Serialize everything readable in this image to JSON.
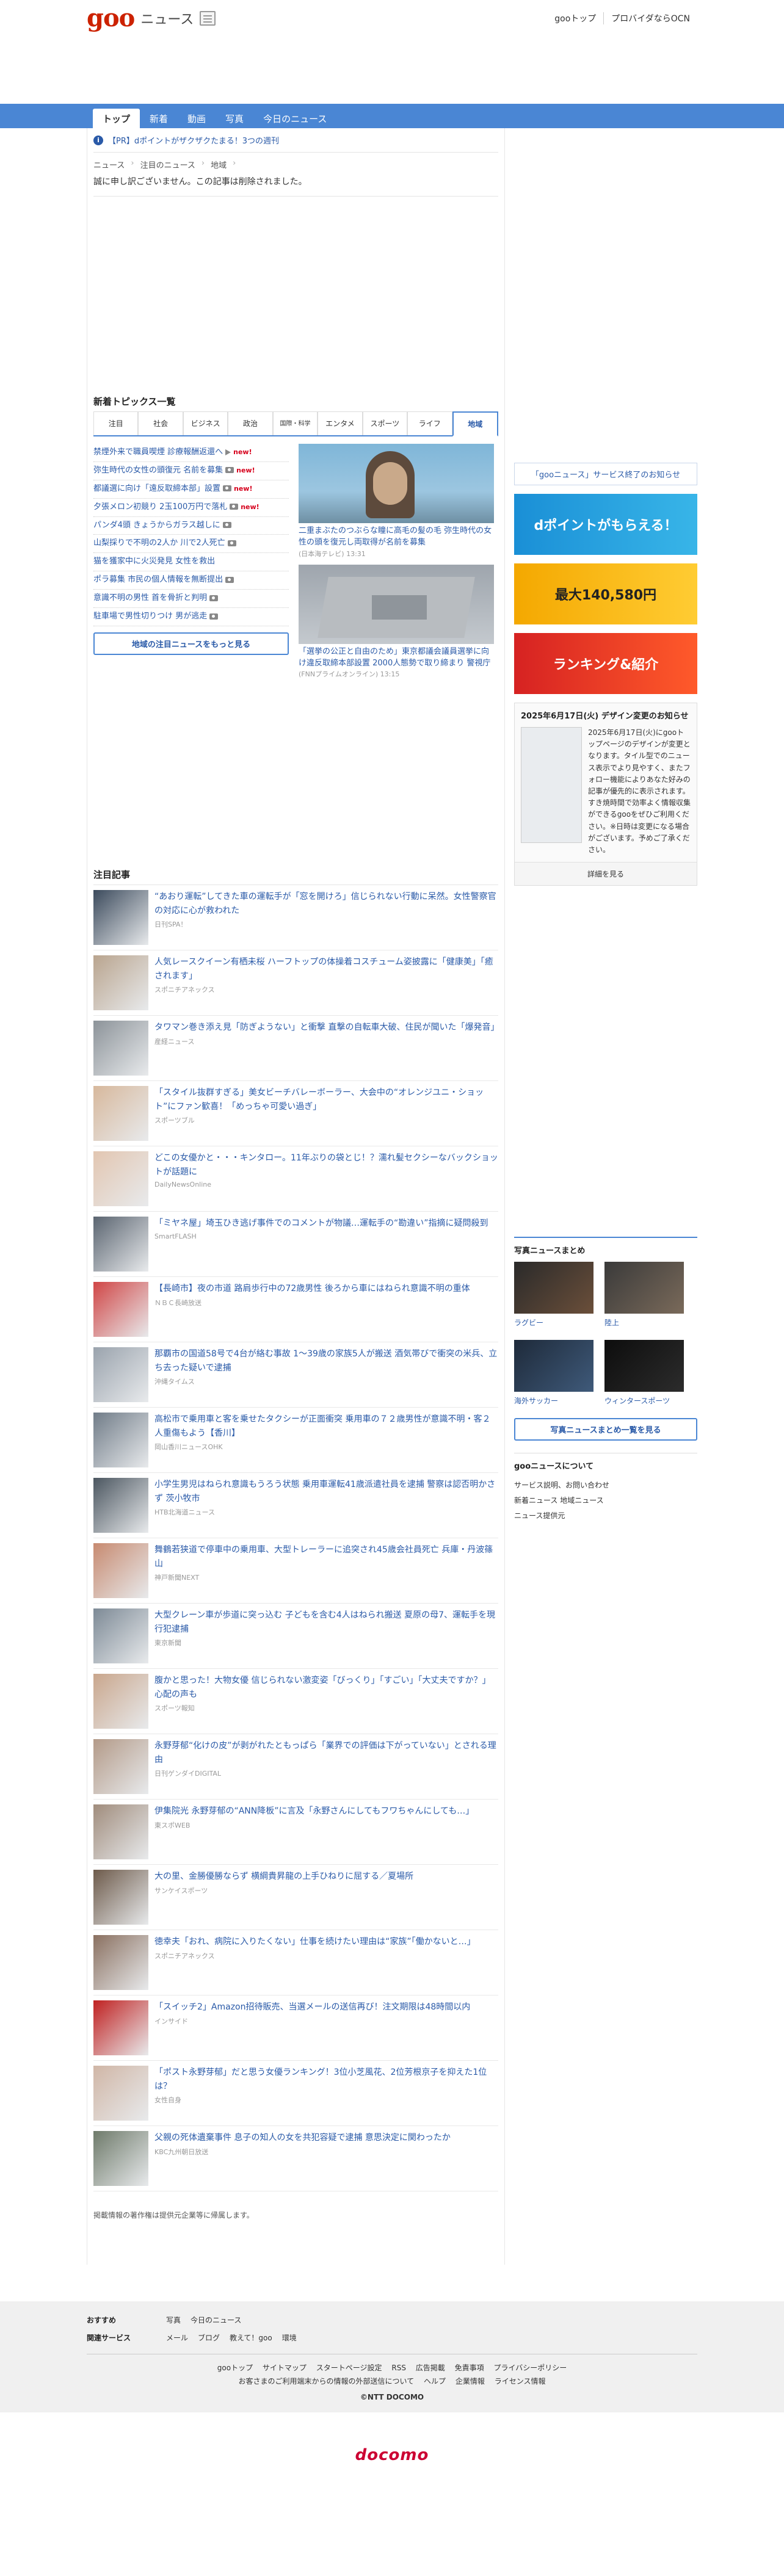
{
  "header": {
    "logo": "goo",
    "logo_sub": "ニュース",
    "links": [
      "gooトップ",
      "プロバイダならOCN"
    ]
  },
  "gnav": [
    "トップ",
    "新着",
    "動画",
    "写真",
    "今日のニュース"
  ],
  "pr": "【PR】dポイントがザクザクたまる！3つの週刊",
  "breadcrumb": [
    "ニュース",
    "注目のニュース",
    "地域"
  ],
  "deleted_msg": "誠に申し訳ございません。この記事は削除されました。",
  "topics": {
    "heading": "新着トピックス一覧",
    "tabs": [
      "注目",
      "社会",
      "ビジネス",
      "政治",
      "国際・科学",
      "エンタメ",
      "スポーツ",
      "ライフ",
      "地域"
    ],
    "items": [
      {
        "text": "禁煙外来で職員喫煙 診療報酬返還へ",
        "icon": "video",
        "new": "new!"
      },
      {
        "text": "弥生時代の女性の頭復元 名前を募集",
        "icon": "camera",
        "new": "new!"
      },
      {
        "text": "都議選に向け「遠反取締本部」設置",
        "icon": "camera",
        "new": "new!"
      },
      {
        "text": "夕張メロン初競り 2玉100万円で落札",
        "icon": "camera",
        "new": "new!"
      },
      {
        "text": "パンダ4頭 きょうからガラス越しに",
        "icon": "camera",
        "new": ""
      },
      {
        "text": "山梨採りで不明の2人か 川で2人死亡",
        "icon": "camera",
        "new": ""
      },
      {
        "text": "猫を獲家中に火災発見 女性を救出",
        "icon": "",
        "new": ""
      },
      {
        "text": "ポラ募集 市民の個人情報を無断提出",
        "icon": "camera",
        "new": ""
      },
      {
        "text": "意識不明の男性 首を骨折と判明",
        "icon": "camera",
        "new": ""
      },
      {
        "text": "駐車場で男性切りつけ 男が逃走",
        "icon": "camera",
        "new": ""
      }
    ],
    "more": "地域の注目ニュースをもっと見る",
    "pics": [
      {
        "cap": "二重まぶたのつぶらな瞳に高毛の髪の毛 弥生時代の女性の頭を復元し両取得が名前を募集",
        "src": "(日本海テレビ) 13:31"
      },
      {
        "cap": "「選挙の公正と自由のため」東京都議会議員選挙に向け違反取締本部設置 2000人態勢で取り締まり 警視庁",
        "src": "(FNNプライムオンライン) 13:15"
      }
    ]
  },
  "featured": {
    "heading": "注目記事",
    "items": [
      {
        "title": "“あおり運転”してきた車の運転手が「窓を開けろ」信じられない行動に呆然。女性警察官の対応に心が救われた",
        "src": "日刊SPA！"
      },
      {
        "title": "人気レースクイーン有栖未桜 ハーフトップの体操着コスチューム姿披露に「健康美」「癒されます」",
        "src": "スポニチアネックス"
      },
      {
        "title": "タワマン巻き添え見「防ぎようない」と衝撃 直撃の自転車大破、住民が聞いた「爆発音」",
        "src": "産経ニュース"
      },
      {
        "title": "「スタイル抜群すぎる」美女ビーチバレーボーラー、大会中の“オレンジユニ・ショット”にファン歓喜！「めっちゃ可愛い過ぎ」",
        "src": "スポーツブル"
      },
      {
        "title": "どこの女優かと・・・キンタロー。11年ぶりの袋とじ！？濡れ髪セクシーなバックショットが話題に",
        "src": "DailyNewsOnline"
      },
      {
        "title": "「ミヤネ屋」埼玉ひき逃げ事件でのコメントが物議…運転手の“勘違い”指摘に疑問殺到",
        "src": "SmartFLASH"
      },
      {
        "title": "【長崎市】夜の市道 路肩歩行中の72歳男性 後ろから車にはねられ意識不明の重体",
        "src": "ＮＢＣ長崎放送"
      },
      {
        "title": "那覇市の国道58号で4台が絡む事故 1～39歳の家族5人が搬送 酒気帯びで衝突の米兵、立ち去った疑いで逮捕",
        "src": "沖縄タイムス"
      },
      {
        "title": "高松市で乗用車と客を乗せたタクシーが正面衝突 乗用車の７２歳男性が意識不明・客２人重傷もよう【香川】",
        "src": "岡山香川ニュースOHK"
      },
      {
        "title": "小学生男児はねられ意識もうろう状態 乗用車運転41歳派遣社員を逮捕 警察は認否明かさず 茨小牧市",
        "src": "HTB北海道ニュース"
      },
      {
        "title": "舞鶴若狭道で停車中の乗用車、大型トレーラーに追突され45歳会社員死亡 兵庫・丹波篠山",
        "src": "神戸新聞NEXT"
      },
      {
        "title": "大型クレーン車が歩道に突っ込む 子どもを含む4人はねられ搬送 夏原の母7、運転手を現行犯逮捕",
        "src": "東京新聞"
      },
      {
        "title": "腹かと思った！大物女優 信じられない激変姿「びっくり」「すごい」「大丈夫ですか？」心配の声も",
        "src": "スポーツ報知"
      },
      {
        "title": "永野芽郁“化けの皮”が剥がれたともっぱら「業界での評価は下がっていない」とされる理由",
        "src": "日刊ゲンダイDIGITAL"
      },
      {
        "title": "伊集院光 永野芽郁の“ANN降板”に言及「永野さんにしてもフワちゃんにしても…」",
        "src": "東スポWEB"
      },
      {
        "title": "大の里、金勝優勝ならず 横綱貴昇龍の上手ひねりに屈する／夏場所",
        "src": "サンケイスポーツ"
      },
      {
        "title": "徳幸夫「おれ、病院に入りたくない」仕事を続けたい理由は“家族”「働かないと…」",
        "src": "スポニチアネックス"
      },
      {
        "title": "「スイッチ2」Amazon招待販売、当選メールの送信再び！注文期限は48時間以内",
        "src": "インサイド"
      },
      {
        "title": "「ポスト永野芽郁」だと思う女優ランキング！3位小芝風花、2位芳根京子を抑えた1位は？",
        "src": "女性自身"
      },
      {
        "title": "父親の死体遺棄事件 息子の知人の女を共犯容疑で逮捕 意思決定に関わったか",
        "src": "KBC九州朝日放送"
      }
    ]
  },
  "copyright_note": "掲載情報の著作権は提供元企業等に帰属します。",
  "side": {
    "notice": "「gooニュース」サービス終了のお知らせ",
    "banners": [
      "dポイントがもらえる！",
      "最大140,580円",
      "ランキング&紹介"
    ],
    "design": {
      "title": "2025年6月17日(火) デザイン変更のお知らせ",
      "body": "2025年6月17日(火)にgooトップページのデザインが変更となります。タイル型でのニュース表示でより見やすく、またフォロー機能によりあなた好みの記事が優先的に表示されます。すき焼時間で効率よく情報収集ができるgooをぜひご利用ください。※日時は変更になる場合がございます。予めご了承ください。",
      "more": "詳細を見る"
    },
    "photo": {
      "heading": "写真ニュースまとめ",
      "cells": [
        "ラグビー",
        "陸上",
        "海外サッカー",
        "ウィンタースポーツ"
      ],
      "more": "写真ニュースまとめ一覧を見る"
    },
    "about": {
      "heading": "gooニュースについて",
      "items": [
        "サービス説明、お問い合わせ",
        "新着ニュース 地域ニュース",
        "ニュース提供元"
      ]
    }
  },
  "footer": {
    "recommend_label": "おすすめ",
    "recommend": [
      "写真",
      "今日のニュース"
    ],
    "related_label": "関連サービス",
    "related": [
      "メール",
      "ブログ",
      "教えて！goo",
      "環境"
    ],
    "links1": [
      "gooトップ",
      "サイトマップ",
      "スタートページ設定",
      "RSS",
      "広告掲載",
      "免責事項",
      "プライバシーポリシー"
    ],
    "links2": [
      "お客さまのご利用端末からの情報の外部送信について",
      "ヘルプ",
      "企業情報",
      "ライセンス情報"
    ],
    "copy": "©NTT DOCOMO",
    "brand": "docomo"
  }
}
